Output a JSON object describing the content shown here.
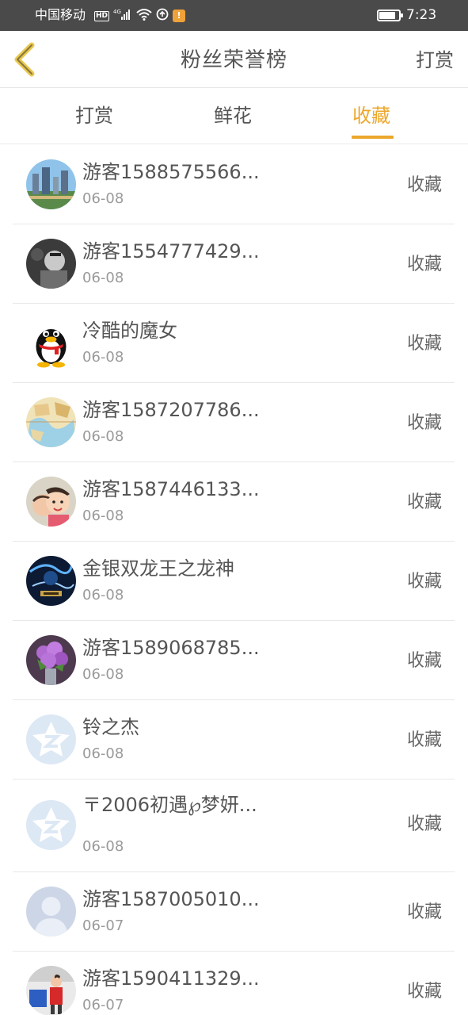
{
  "status_bar": {
    "carrier": "中国移动",
    "network_badge": "HD",
    "signal": "4G",
    "warning_icon": "!",
    "battery_level": 0.85,
    "time": "7:23"
  },
  "header": {
    "title": "粉丝荣誉榜",
    "action_label": "打赏",
    "back_icon": "chevron-left-icon"
  },
  "tabs": [
    {
      "label": "打赏",
      "active": false
    },
    {
      "label": "鲜花",
      "active": false
    },
    {
      "label": "收藏",
      "active": true
    }
  ],
  "colors": {
    "accent": "#eca72c",
    "text": "#555555",
    "muted": "#9a9a9a",
    "status_bar": "#4a4a4a"
  },
  "fans": [
    {
      "name": "游客1588575566...",
      "date": "06-08",
      "action": "收藏",
      "avatar": "city-avatar"
    },
    {
      "name": "游客1554777429...",
      "date": "06-08",
      "action": "收藏",
      "avatar": "photo-avatar"
    },
    {
      "name": "冷酷的魔女",
      "date": "06-08",
      "action": "收藏",
      "avatar": "penguin-avatar"
    },
    {
      "name": "游客1587207786...",
      "date": "06-08",
      "action": "收藏",
      "avatar": "map-avatar"
    },
    {
      "name": "游客1587446133...",
      "date": "06-08",
      "action": "收藏",
      "avatar": "kids-avatar"
    },
    {
      "name": "金银双龙王之龙神",
      "date": "06-08",
      "action": "收藏",
      "avatar": "game-avatar"
    },
    {
      "name": "游客1589068785...",
      "date": "06-08",
      "action": "收藏",
      "avatar": "flower-avatar"
    },
    {
      "name": "铃之杰",
      "date": "06-08",
      "action": "收藏",
      "avatar": "default-star-avatar"
    },
    {
      "name": "〒2006初遇℘梦妍...",
      "date": "06-08",
      "action": "收藏",
      "avatar": "default-star-avatar"
    },
    {
      "name": "游客1587005010...",
      "date": "06-07",
      "action": "收藏",
      "avatar": "default-person-avatar"
    },
    {
      "name": "游客1590411329...",
      "date": "06-07",
      "action": "收藏",
      "avatar": "child-avatar"
    }
  ]
}
